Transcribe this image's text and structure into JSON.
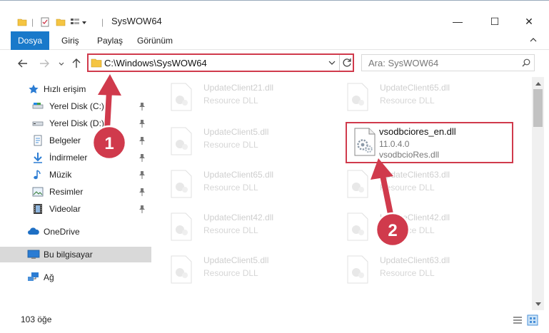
{
  "window": {
    "title": "SysWOW64",
    "minimize": "—",
    "maximize": "☐",
    "close": "✕"
  },
  "ribbon": {
    "tabs": [
      "Dosya",
      "Giriş",
      "Paylaş",
      "Görünüm"
    ]
  },
  "address": {
    "path": "C:\\Windows\\SysWOW64",
    "search_placeholder": "Ara: SysWOW64"
  },
  "sidebar": {
    "quick_access": "Hızlı erişim",
    "items": [
      {
        "label": "Yerel Disk (C:)",
        "pinned": true
      },
      {
        "label": "Yerel Disk (D:)",
        "pinned": true
      },
      {
        "label": "Belgeler",
        "pinned": true
      },
      {
        "label": "İndirmeler",
        "pinned": true
      },
      {
        "label": "Müzik",
        "pinned": true
      },
      {
        "label": "Resimler",
        "pinned": true
      },
      {
        "label": "Videolar",
        "pinned": true
      }
    ],
    "onedrive": "OneDrive",
    "this_pc": "Bu bilgisayar",
    "network": "Ağ"
  },
  "files": {
    "left_column": [
      {
        "name": "UpdateClient21.dll",
        "type": "Resource DLL"
      },
      {
        "name": "UpdateClient5.dll",
        "type": "Resource DLL"
      },
      {
        "name": "UpdateClient65.dll",
        "type": "Resource DLL"
      },
      {
        "name": "UpdateClient42.dll",
        "type": "Resource DLL"
      },
      {
        "name": "UpdateClient5.dll",
        "type": "Resource DLL"
      }
    ],
    "right_column": [
      {
        "name": "UpdateClient65.dll",
        "type": "Resource DLL"
      },
      {
        "name": "UpdateClient63.dll",
        "type": "Resource DLL"
      },
      {
        "name": "UpdateClient42.dll",
        "type": "Resource DLL"
      },
      {
        "name": "UpdateClient63.dll",
        "type": "Resource DLL"
      }
    ],
    "highlighted": {
      "name": "vsodbciores_en.dll",
      "version": "11.0.4.0",
      "type": "vsodbcioRes.dll"
    }
  },
  "annotations": {
    "badge1": "1",
    "badge2": "2",
    "color": "#d03a4c"
  },
  "status": {
    "item_count": "103 öğe"
  }
}
